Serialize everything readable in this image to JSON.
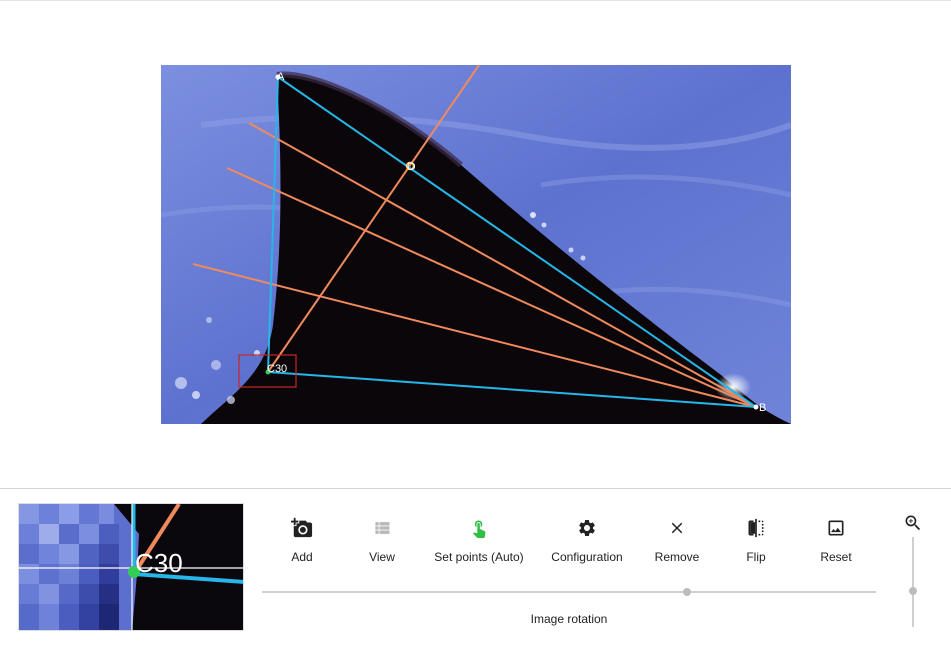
{
  "canvas": {
    "points": {
      "a_label": "A",
      "b_label": "B",
      "o_label": "O",
      "c_label": "C30"
    },
    "colors": {
      "outline_line": "#27b6e8",
      "ray_line": "#f08a5d",
      "selection_box": "#c62828",
      "water": "#6b7fd4",
      "fin": "#0a0509"
    }
  },
  "magnifier": {
    "point_label": "C30"
  },
  "toolbar": {
    "add_label": "Add",
    "view_label": "View",
    "set_points_label": "Set points (Auto)",
    "configuration_label": "Configuration",
    "remove_label": "Remove",
    "flip_label": "Flip",
    "reset_label": "Reset",
    "icons": [
      "add-photo-icon",
      "list-view-icon",
      "touch-pointer-icon",
      "gear-icon",
      "close-icon",
      "flip-icon",
      "image-reset-icon"
    ],
    "active_color": "#2fbf45"
  },
  "rotation": {
    "label": "Image rotation",
    "value_fraction": 0.69
  },
  "zoom": {
    "icon": "zoom-in-icon",
    "value_fraction": 0.55
  }
}
